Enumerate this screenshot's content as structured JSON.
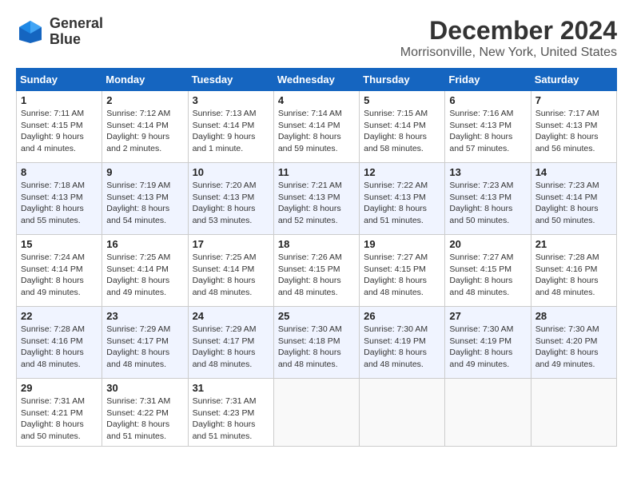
{
  "header": {
    "logo_line1": "General",
    "logo_line2": "Blue",
    "month_title": "December 2024",
    "location": "Morrisonville, New York, United States"
  },
  "calendar": {
    "days_of_week": [
      "Sunday",
      "Monday",
      "Tuesday",
      "Wednesday",
      "Thursday",
      "Friday",
      "Saturday"
    ],
    "weeks": [
      [
        null,
        {
          "day": "2",
          "sunrise": "Sunrise: 7:12 AM",
          "sunset": "Sunset: 4:14 PM",
          "daylight": "Daylight: 9 hours and 2 minutes."
        },
        {
          "day": "3",
          "sunrise": "Sunrise: 7:13 AM",
          "sunset": "Sunset: 4:14 PM",
          "daylight": "Daylight: 9 hours and 1 minute."
        },
        {
          "day": "4",
          "sunrise": "Sunrise: 7:14 AM",
          "sunset": "Sunset: 4:14 PM",
          "daylight": "Daylight: 8 hours and 59 minutes."
        },
        {
          "day": "5",
          "sunrise": "Sunrise: 7:15 AM",
          "sunset": "Sunset: 4:14 PM",
          "daylight": "Daylight: 8 hours and 58 minutes."
        },
        {
          "day": "6",
          "sunrise": "Sunrise: 7:16 AM",
          "sunset": "Sunset: 4:13 PM",
          "daylight": "Daylight: 8 hours and 57 minutes."
        },
        {
          "day": "7",
          "sunrise": "Sunrise: 7:17 AM",
          "sunset": "Sunset: 4:13 PM",
          "daylight": "Daylight: 8 hours and 56 minutes."
        }
      ],
      [
        {
          "day": "1",
          "sunrise": "Sunrise: 7:11 AM",
          "sunset": "Sunset: 4:15 PM",
          "daylight": "Daylight: 9 hours and 4 minutes."
        },
        {
          "day": "8",
          "sunrise": "Sunrise: 7:18 AM",
          "sunset": "Sunset: 4:13 PM",
          "daylight": "Daylight: 8 hours and 55 minutes."
        },
        {
          "day": "9",
          "sunrise": "Sunrise: 7:19 AM",
          "sunset": "Sunset: 4:13 PM",
          "daylight": "Daylight: 8 hours and 54 minutes."
        },
        {
          "day": "10",
          "sunrise": "Sunrise: 7:20 AM",
          "sunset": "Sunset: 4:13 PM",
          "daylight": "Daylight: 8 hours and 53 minutes."
        },
        {
          "day": "11",
          "sunrise": "Sunrise: 7:21 AM",
          "sunset": "Sunset: 4:13 PM",
          "daylight": "Daylight: 8 hours and 52 minutes."
        },
        {
          "day": "12",
          "sunrise": "Sunrise: 7:22 AM",
          "sunset": "Sunset: 4:13 PM",
          "daylight": "Daylight: 8 hours and 51 minutes."
        },
        {
          "day": "13",
          "sunrise": "Sunrise: 7:23 AM",
          "sunset": "Sunset: 4:13 PM",
          "daylight": "Daylight: 8 hours and 50 minutes."
        },
        {
          "day": "14",
          "sunrise": "Sunrise: 7:23 AM",
          "sunset": "Sunset: 4:14 PM",
          "daylight": "Daylight: 8 hours and 50 minutes."
        }
      ],
      [
        {
          "day": "15",
          "sunrise": "Sunrise: 7:24 AM",
          "sunset": "Sunset: 4:14 PM",
          "daylight": "Daylight: 8 hours and 49 minutes."
        },
        {
          "day": "16",
          "sunrise": "Sunrise: 7:25 AM",
          "sunset": "Sunset: 4:14 PM",
          "daylight": "Daylight: 8 hours and 49 minutes."
        },
        {
          "day": "17",
          "sunrise": "Sunrise: 7:25 AM",
          "sunset": "Sunset: 4:14 PM",
          "daylight": "Daylight: 8 hours and 48 minutes."
        },
        {
          "day": "18",
          "sunrise": "Sunrise: 7:26 AM",
          "sunset": "Sunset: 4:15 PM",
          "daylight": "Daylight: 8 hours and 48 minutes."
        },
        {
          "day": "19",
          "sunrise": "Sunrise: 7:27 AM",
          "sunset": "Sunset: 4:15 PM",
          "daylight": "Daylight: 8 hours and 48 minutes."
        },
        {
          "day": "20",
          "sunrise": "Sunrise: 7:27 AM",
          "sunset": "Sunset: 4:15 PM",
          "daylight": "Daylight: 8 hours and 48 minutes."
        },
        {
          "day": "21",
          "sunrise": "Sunrise: 7:28 AM",
          "sunset": "Sunset: 4:16 PM",
          "daylight": "Daylight: 8 hours and 48 minutes."
        }
      ],
      [
        {
          "day": "22",
          "sunrise": "Sunrise: 7:28 AM",
          "sunset": "Sunset: 4:16 PM",
          "daylight": "Daylight: 8 hours and 48 minutes."
        },
        {
          "day": "23",
          "sunrise": "Sunrise: 7:29 AM",
          "sunset": "Sunset: 4:17 PM",
          "daylight": "Daylight: 8 hours and 48 minutes."
        },
        {
          "day": "24",
          "sunrise": "Sunrise: 7:29 AM",
          "sunset": "Sunset: 4:17 PM",
          "daylight": "Daylight: 8 hours and 48 minutes."
        },
        {
          "day": "25",
          "sunrise": "Sunrise: 7:30 AM",
          "sunset": "Sunset: 4:18 PM",
          "daylight": "Daylight: 8 hours and 48 minutes."
        },
        {
          "day": "26",
          "sunrise": "Sunrise: 7:30 AM",
          "sunset": "Sunset: 4:19 PM",
          "daylight": "Daylight: 8 hours and 48 minutes."
        },
        {
          "day": "27",
          "sunrise": "Sunrise: 7:30 AM",
          "sunset": "Sunset: 4:19 PM",
          "daylight": "Daylight: 8 hours and 49 minutes."
        },
        {
          "day": "28",
          "sunrise": "Sunrise: 7:30 AM",
          "sunset": "Sunset: 4:20 PM",
          "daylight": "Daylight: 8 hours and 49 minutes."
        }
      ],
      [
        {
          "day": "29",
          "sunrise": "Sunrise: 7:31 AM",
          "sunset": "Sunset: 4:21 PM",
          "daylight": "Daylight: 8 hours and 50 minutes."
        },
        {
          "day": "30",
          "sunrise": "Sunrise: 7:31 AM",
          "sunset": "Sunset: 4:22 PM",
          "daylight": "Daylight: 8 hours and 51 minutes."
        },
        {
          "day": "31",
          "sunrise": "Sunrise: 7:31 AM",
          "sunset": "Sunset: 4:23 PM",
          "daylight": "Daylight: 8 hours and 51 minutes."
        },
        null,
        null,
        null,
        null
      ]
    ]
  }
}
